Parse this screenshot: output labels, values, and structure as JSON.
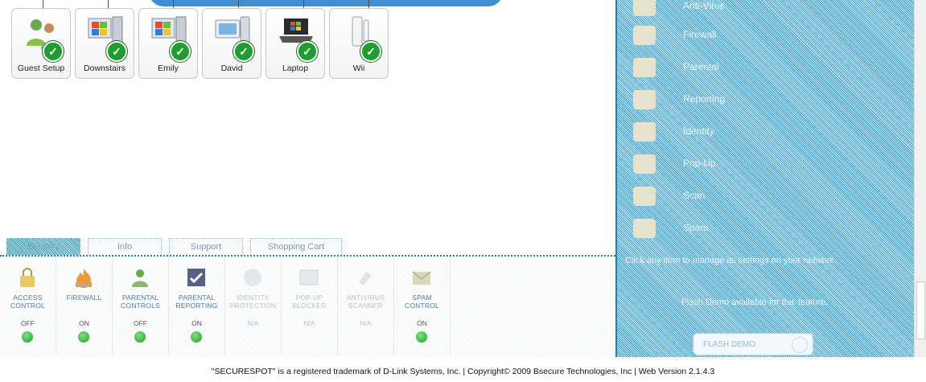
{
  "devices": [
    {
      "label": "Guest Setup",
      "icon": "users-icon"
    },
    {
      "label": "Downstairs",
      "icon": "windows-pc-icon"
    },
    {
      "label": "Emily",
      "icon": "windows-pc-icon"
    },
    {
      "label": "David",
      "icon": "mac-icon"
    },
    {
      "label": "Laptop",
      "icon": "laptop-icon"
    },
    {
      "label": "Wii",
      "icon": "wii-console-icon"
    }
  ],
  "tabs": [
    "Security",
    "Info",
    "Support",
    "Shopping Cart"
  ],
  "tools": [
    {
      "name": "ACCESS CONTROL",
      "state": "OFF",
      "icon": "lock-icon"
    },
    {
      "name": "FIREWALL",
      "state": "ON",
      "icon": "fire-icon"
    },
    {
      "name": "PARENTAL CONTROLS",
      "state": "OFF",
      "icon": "parental-icon"
    },
    {
      "name": "PARENTAL REPORTING",
      "state": "ON",
      "icon": "report-icon"
    },
    {
      "name": "IDENTITY PROTECTION",
      "state": "N/A",
      "icon": "identity-icon"
    },
    {
      "name": "POP-UP BLOCKER",
      "state": "N/A",
      "icon": "popup-icon"
    },
    {
      "name": "ANTIVIRUS SCANNER",
      "state": "N/A",
      "icon": "antivirus-icon"
    },
    {
      "name": "SPAM CONTROL",
      "state": "ON",
      "icon": "spam-icon"
    }
  ],
  "right_menu": [
    "Anti-Virus",
    "Firewall",
    "Parental",
    "Reporting",
    "Identity",
    "Pop-Up",
    "Scan",
    "Spam"
  ],
  "right_text_1": "Click any item to manage its settings on your network.",
  "right_text_2": "Flash Demo available for this feature.",
  "flash_button": "FLASH DEMO",
  "footer": "\"SECURESPOT\" is a registered trademark of D-Link Systems, Inc. | Copyright© 2009 Bsecure Technologies, Inc | Web Version 2.1.4.3",
  "colors": {
    "accent": "#1e7fb3",
    "ok": "#1f9d2f"
  }
}
